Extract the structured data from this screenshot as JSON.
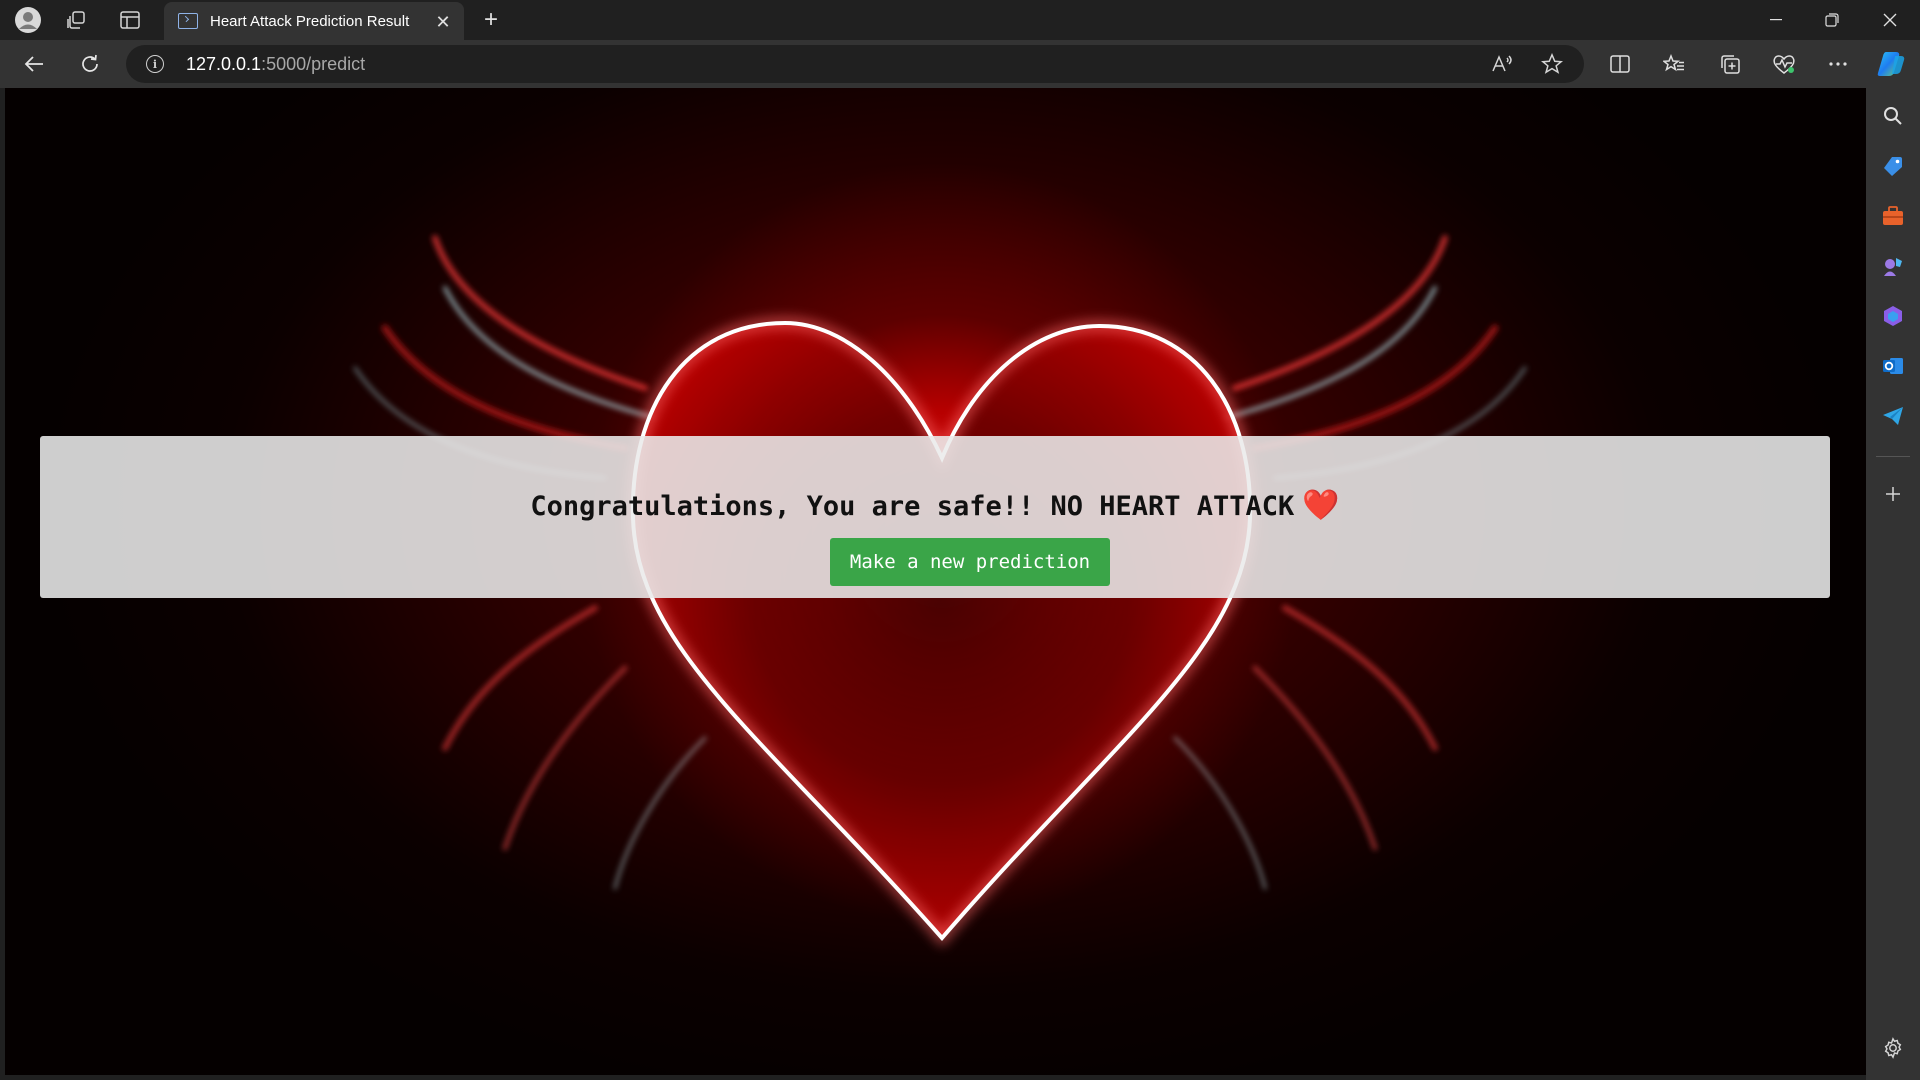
{
  "browser": {
    "tab": {
      "title": "Heart Attack Prediction Result",
      "favicon": "page-icon"
    },
    "address": {
      "host": "127.0.0.1",
      "path": ":5000/predict"
    },
    "icons": {
      "profile": "profile-icon",
      "workspaces": "workspaces-icon",
      "tab_actions": "vertical-tabs-icon",
      "close_tab": "close-icon",
      "new_tab": "plus-icon",
      "minimize": "minimize-icon",
      "restore": "restore-icon",
      "close_window": "close-window-icon",
      "back": "back-arrow-icon",
      "refresh": "refresh-icon",
      "site_info": "info-icon",
      "read_aloud": "read-aloud-icon",
      "favorite": "star-icon",
      "split_screen": "split-screen-icon",
      "favorites": "favorites-icon",
      "collections": "collections-icon",
      "browser_essentials": "heart-pulse-icon",
      "more": "more-icon",
      "copilot": "copilot-icon"
    },
    "sidebar_icons": [
      "search-icon",
      "shopping-icon",
      "tools-icon",
      "games-icon",
      "office-icon",
      "outlook-icon",
      "telegram-icon",
      "add-icon",
      "settings-icon"
    ]
  },
  "page": {
    "result_message": "Congratulations, You are safe!! NO HEART ATTACK",
    "result_emoji": "❤️",
    "button_label": "Make a new prediction",
    "colors": {
      "button": "#3aa548",
      "heart_outline": "#ffffff",
      "glow": "#e00000"
    }
  }
}
